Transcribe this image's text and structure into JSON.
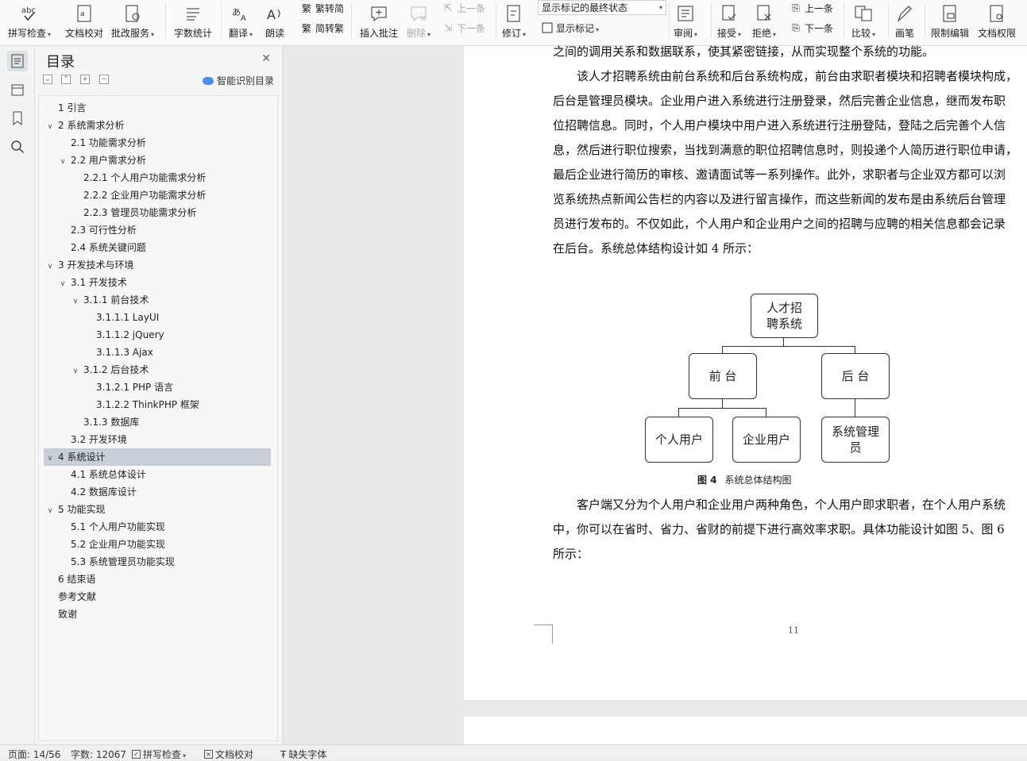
{
  "ribbon": {
    "spell_check": "拼写检查",
    "doc_proof": "文档校对",
    "batch_service": "批改服务",
    "word_count": "字数统计",
    "translate": "翻译",
    "read_aloud": "朗读",
    "trad_to_simp": "繁转简",
    "simp_to_trad": "简转繁",
    "insert_comment": "插入批注",
    "delete": "删除",
    "prev_comment": "上一条",
    "next_comment": "下一条",
    "track_changes": "修订",
    "markup_state": "显示标记的最终状态",
    "show_markup": "显示标记",
    "review": "审阅",
    "accept": "接受",
    "reject": "拒绝",
    "prev_change": "上一条",
    "next_change": "下一条",
    "compare": "比较",
    "ink": "画笔",
    "restrict_edit": "限制编辑",
    "doc_permission": "文档权限"
  },
  "toc": {
    "title": "目录",
    "smart_toc": "智能识别目录",
    "items": [
      {
        "label": "1 引言",
        "arrow": ""
      },
      {
        "label": "2 系统需求分析",
        "arrow": "∨"
      },
      {
        "label": "2.1 功能需求分析",
        "arrow": ""
      },
      {
        "label": "2.2 用户需求分析",
        "arrow": "∨"
      },
      {
        "label": "2.2.1 个人用户功能需求分析",
        "arrow": ""
      },
      {
        "label": "2.2.2 企业用户功能需求分析",
        "arrow": ""
      },
      {
        "label": "2.2.3 管理员功能需求分析",
        "arrow": ""
      },
      {
        "label": "2.3 可行性分析",
        "arrow": ""
      },
      {
        "label": "2.4 系统关键问题",
        "arrow": ""
      },
      {
        "label": "3 开发技术与环境",
        "arrow": "∨"
      },
      {
        "label": "3.1 开发技术",
        "arrow": "∨"
      },
      {
        "label": "3.1.1 前台技术",
        "arrow": "∨"
      },
      {
        "label": "3.1.1.1 LayUI",
        "arrow": ""
      },
      {
        "label": "3.1.1.2 jQuery",
        "arrow": ""
      },
      {
        "label": "3.1.1.3 Ajax",
        "arrow": ""
      },
      {
        "label": "3.1.2 后台技术",
        "arrow": "∨"
      },
      {
        "label": "3.1.2.1 PHP 语言",
        "arrow": ""
      },
      {
        "label": "3.1.2.2 ThinkPHP 框架",
        "arrow": ""
      },
      {
        "label": "3.1.3 数据库",
        "arrow": ""
      },
      {
        "label": "3.2 开发环境",
        "arrow": ""
      },
      {
        "label": "4 系统设计",
        "arrow": "∨"
      },
      {
        "label": "4.1 系统总体设计",
        "arrow": ""
      },
      {
        "label": "4.2 数据库设计",
        "arrow": ""
      },
      {
        "label": "5 功能实现",
        "arrow": "∨"
      },
      {
        "label": "5.1 个人用户功能实现",
        "arrow": ""
      },
      {
        "label": "5.2 企业用户功能实现",
        "arrow": ""
      },
      {
        "label": "5.3 系统管理员功能实现",
        "arrow": ""
      },
      {
        "label": "6 结束语",
        "arrow": ""
      },
      {
        "label": "参考文献",
        "arrow": ""
      },
      {
        "label": "致谢",
        "arrow": ""
      }
    ],
    "selected_index": 20
  },
  "document": {
    "paragraphs": [
      "之间的调用关系和数据联系，使其紧密链接，从而实现整个系统的功能。",
      "　　该人才招聘系统由前台系统和后台系统构成，前台由求职者模块和招聘者模块构成，",
      "后台是管理员模块。企业用户进入系统进行注册登录，然后完善企业信息，继而发布职",
      "位招聘信息。同时，个人用户模块中用户进入系统进行注册登陆，登陆之后完善个人信",
      "息，然后进行职位搜索，当找到满意的职位招聘信息时，则投递个人简历进行职位申请，",
      "最后企业进行简历的审核、邀请面试等一系列操作。此外，求职者与企业双方都可以浏",
      "览系统热点新闻公告栏的内容以及进行留言操作，而这些新闻的发布是由系统后台管理",
      "员进行发布的。不仅如此，个人用户和企业用户之间的招聘与应聘的相关信息都会记录",
      "在后台。系统总体结构设计如 4 所示："
    ],
    "paragraphs2": [
      "　　客户端又分为个人用户和企业用户两种角色，个人用户即求职者，在个人用户系统",
      "中，你可以在省时、省力、省财的前提下进行高效率求职。具体功能设计如图 5、图 6",
      "所示："
    ],
    "diagram": {
      "root": "人才招聘系统",
      "front": "前 台",
      "back": "后 台",
      "personal": "个人用户",
      "enterprise": "企业用户",
      "admin": "系统管理员"
    },
    "caption_num": "图 4",
    "caption_text": "系统总体结构图",
    "page_number": "11"
  },
  "status": {
    "page": "页面: 14/56",
    "words": "字数: 12067",
    "spell": "拼写检查",
    "proof": "文档校对",
    "missing_font": "缺失字体"
  }
}
